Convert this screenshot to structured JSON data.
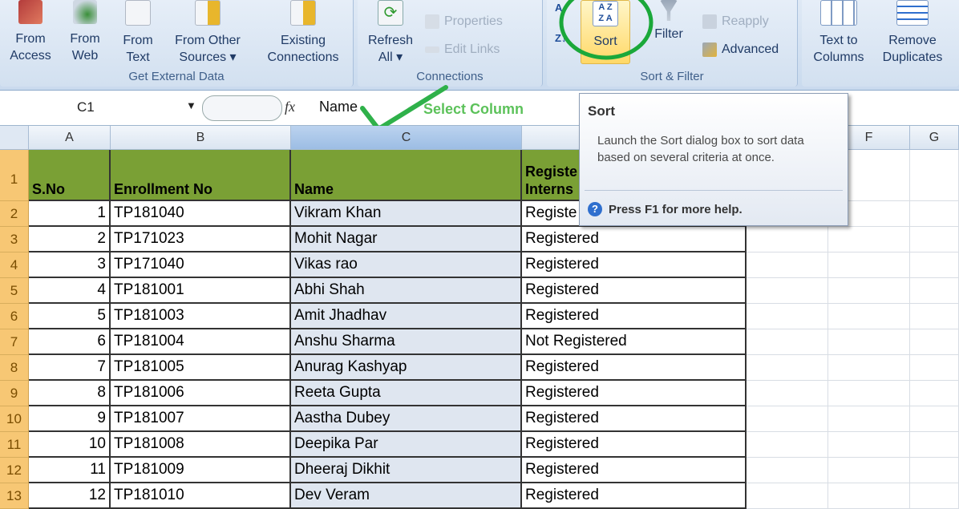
{
  "ribbon": {
    "groups": {
      "external": "Get External Data",
      "connections": "Connections",
      "sortfilter": "Sort & Filter"
    },
    "from_access": [
      "From",
      "Access"
    ],
    "from_web": [
      "From",
      "Web"
    ],
    "from_text": [
      "From",
      "Text"
    ],
    "from_other": [
      "From Other",
      "Sources ▾"
    ],
    "existing": [
      "Existing",
      "Connections"
    ],
    "refresh": [
      "Refresh",
      "All ▾"
    ],
    "properties": "Properties",
    "edit_links": "Edit Links",
    "sort": "Sort",
    "filter": "Filter",
    "reapply": "Reapply",
    "advanced": "Advanced",
    "text_to_columns": [
      "Text to",
      "Columns"
    ],
    "remove_duplicates": [
      "Remove",
      "Duplicates"
    ]
  },
  "formula_bar": {
    "name_box": "C1",
    "fx": "fx",
    "value": "Name",
    "annotation": "Select Column"
  },
  "columns": [
    "A",
    "B",
    "C",
    "",
    "F",
    "G"
  ],
  "header_row": {
    "num": "1",
    "a": "S.No",
    "b": "Enrollment No",
    "c": "Name",
    "d_line1": "Registe",
    "d_line2": "Interns"
  },
  "rows": [
    {
      "num": "2",
      "a": "1",
      "b": "TP181040",
      "c": "Vikram Khan",
      "d": "Registe"
    },
    {
      "num": "3",
      "a": "2",
      "b": "TP171023",
      "c": "Mohit Nagar",
      "d": "Registered"
    },
    {
      "num": "4",
      "a": "3",
      "b": "TP171040",
      "c": "Vikas rao",
      "d": "Registered"
    },
    {
      "num": "5",
      "a": "4",
      "b": "TP181001",
      "c": "Abhi Shah",
      "d": "Registered"
    },
    {
      "num": "6",
      "a": "5",
      "b": "TP181003",
      "c": "Amit Jhadhav",
      "d": "Registered"
    },
    {
      "num": "7",
      "a": "6",
      "b": "TP181004",
      "c": "Anshu Sharma",
      "d": "Not Registered"
    },
    {
      "num": "8",
      "a": "7",
      "b": "TP181005",
      "c": "Anurag Kashyap",
      "d": "Registered"
    },
    {
      "num": "9",
      "a": "8",
      "b": "TP181006",
      "c": "Reeta Gupta",
      "d": "Registered"
    },
    {
      "num": "10",
      "a": "9",
      "b": "TP181007",
      "c": "Aastha Dubey",
      "d": "Registered"
    },
    {
      "num": "11",
      "a": "10",
      "b": "TP181008",
      "c": "Deepika Par",
      "d": "Registered"
    },
    {
      "num": "12",
      "a": "11",
      "b": "TP181009",
      "c": "Dheeraj Dikhit",
      "d": "Registered"
    },
    {
      "num": "13",
      "a": "12",
      "b": "TP181010",
      "c": "Dev Veram",
      "d": "Registered"
    }
  ],
  "tooltip": {
    "title": "Sort",
    "description": "Launch the Sort dialog box to sort data based on several criteria at once.",
    "help_icon": "?",
    "help": "Press F1 for more help."
  },
  "colors": {
    "header_fill": "#7aa035",
    "row_header": "#f7c774",
    "annotation_green": "#3cb043"
  },
  "icons": [
    "access-icon",
    "web-globe-icon",
    "text-file-icon",
    "other-sources-icon",
    "existing-connections-icon",
    "refresh-icon",
    "properties-icon",
    "edit-links-icon",
    "sort-az-za-icon",
    "filter-funnel-icon",
    "reapply-icon",
    "advanced-icon",
    "text-to-columns-icon",
    "remove-duplicates-icon",
    "help-icon",
    "checkmark-annotation",
    "circle-annotation"
  ]
}
